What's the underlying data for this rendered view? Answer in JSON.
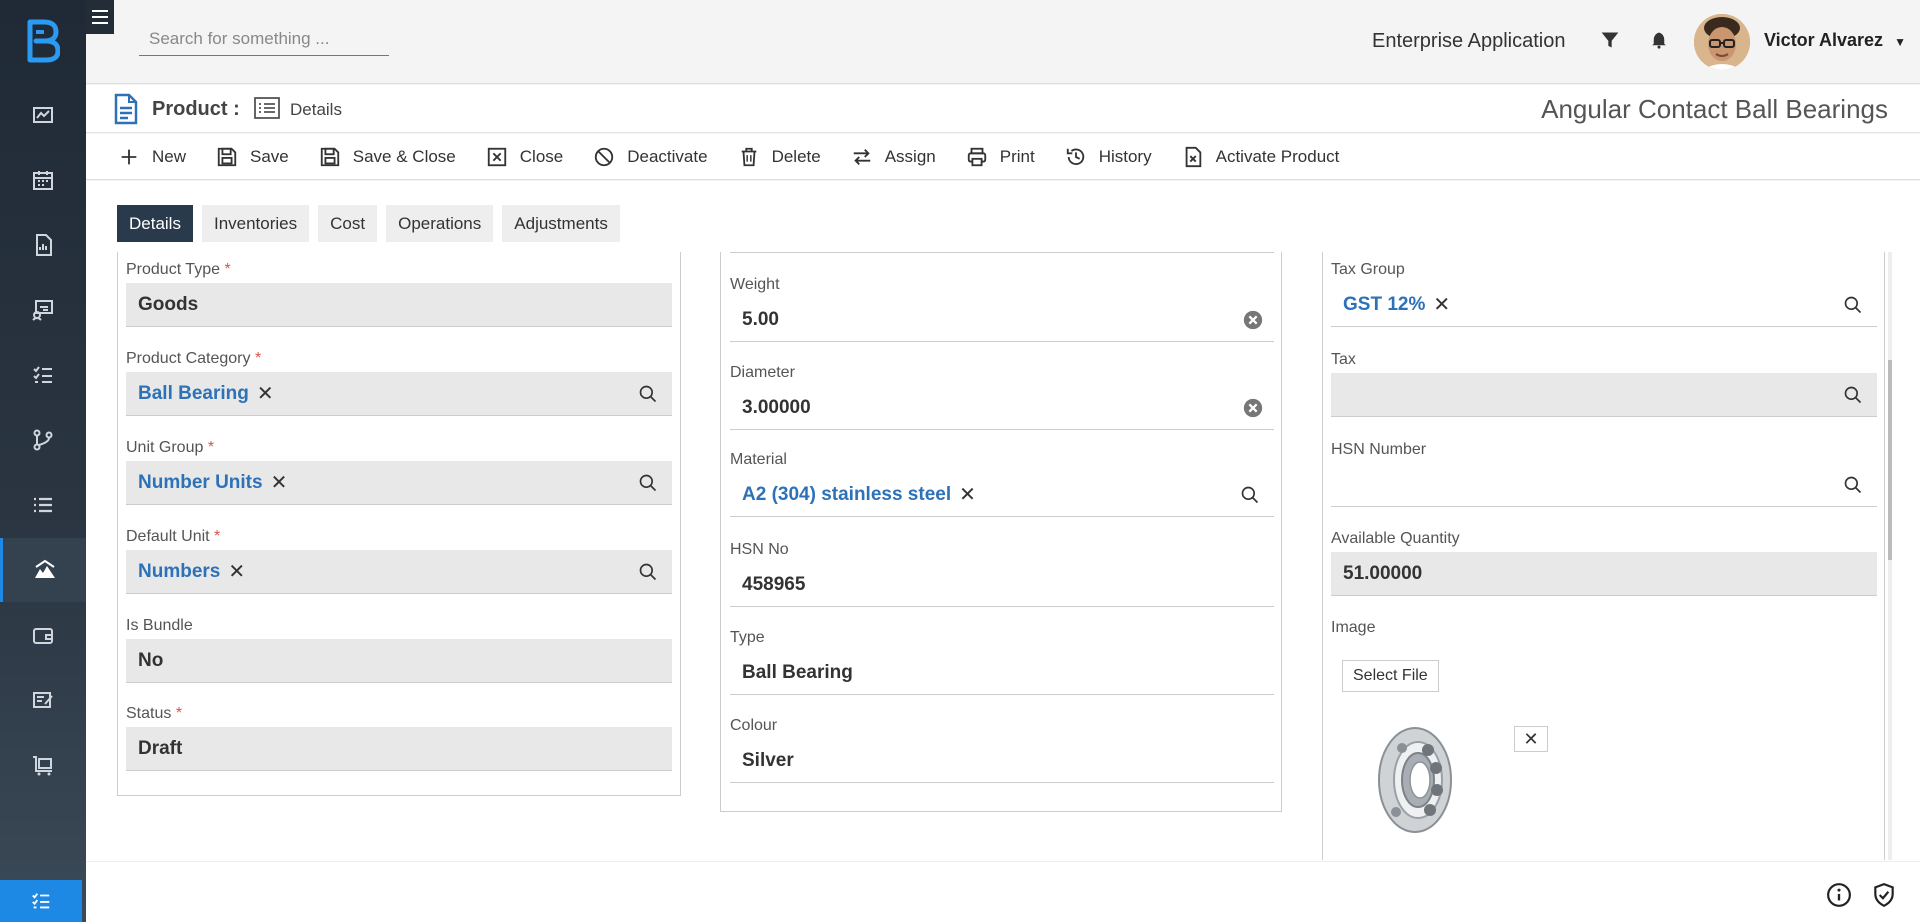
{
  "header": {
    "search_placeholder": "Search for something ...",
    "app_name": "Enterprise Application",
    "user_name": "Victor Alvarez"
  },
  "titlebar": {
    "entity": "Product :",
    "view": "Details",
    "record_name": "Angular Contact Ball Bearings"
  },
  "toolbar": {
    "new": "New",
    "save": "Save",
    "save_close": "Save & Close",
    "close": "Close",
    "deactivate": "Deactivate",
    "delete": "Delete",
    "assign": "Assign",
    "print": "Print",
    "history": "History",
    "activate": "Activate Product"
  },
  "tabs": {
    "details": "Details",
    "inventories": "Inventories",
    "cost": "Cost",
    "operations": "Operations",
    "adjustments": "Adjustments"
  },
  "left": {
    "product_type": {
      "label": "Product Type",
      "value": "Goods"
    },
    "product_category": {
      "label": "Product Category",
      "value": "Ball Bearing"
    },
    "unit_group": {
      "label": "Unit Group",
      "value": "Number Units"
    },
    "default_unit": {
      "label": "Default Unit",
      "value": "Numbers"
    },
    "is_bundle": {
      "label": "Is Bundle",
      "value": "No"
    },
    "status": {
      "label": "Status",
      "value": "Draft"
    },
    "required_mark": "*"
  },
  "middle": {
    "weight": {
      "label": "Weight",
      "value": "5.00"
    },
    "diameter": {
      "label": "Diameter",
      "value": "3.00000"
    },
    "material": {
      "label": "Material",
      "value": "A2 (304) stainless steel"
    },
    "hsn_no": {
      "label": "HSN No",
      "value": "458965"
    },
    "type": {
      "label": "Type",
      "value": "Ball Bearing"
    },
    "colour": {
      "label": "Colour",
      "value": "Silver"
    }
  },
  "right": {
    "tax_group": {
      "label": "Tax Group",
      "value": "GST 12%"
    },
    "tax": {
      "label": "Tax",
      "value": ""
    },
    "hsn_number": {
      "label": "HSN Number",
      "value": ""
    },
    "available_quantity": {
      "label": "Available Quantity",
      "value": "51.00000"
    },
    "image": {
      "label": "Image",
      "select_file": "Select File",
      "close_glyph": "✕"
    }
  },
  "lookup_remove_glyph": "✕",
  "colors": {
    "sidebar_bg": "#2b3642",
    "accent": "#1e88e5",
    "lookup_text": "#2d72b8",
    "active_tab": "#2a3a4d",
    "required": "#d9534f"
  },
  "icons": {
    "sidebar": [
      "dashboard-icon",
      "calendar-icon",
      "report-icon",
      "chart-board-icon",
      "checklist-icon",
      "branch-icon",
      "list-icon",
      "products-icon",
      "wallet-icon",
      "edit-note-icon",
      "inventory-cart-icon"
    ]
  }
}
